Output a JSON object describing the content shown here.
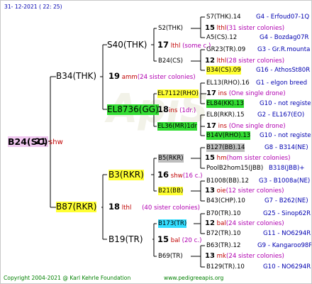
{
  "header": {
    "date": "31- 12-2021 ( 22: 25)"
  },
  "footer": {
    "copyright": "Copyright 2004-2021 @ Karl Kehrle Foundation",
    "url": "www.pedigreeapis.org"
  },
  "colors": {
    "accent_red": "#c00000",
    "link_blue": "#0000b0",
    "sister_magenta": "#b000b0",
    "highlight_yellow": "#ffff33",
    "highlight_green": "#33dd33",
    "highlight_cyan": "#33ddff",
    "highlight_grey": "#bdbdbd",
    "highlight_pink": "#f0c8f0"
  },
  "root": {
    "name": "B24(SC)",
    "num": "21",
    "line": "shw"
  },
  "g1": {
    "top": {
      "name": "B34(THK)",
      "num": "19",
      "line": "amm",
      "note": "(24 sister colonies)"
    },
    "bot": {
      "name": "B87(RKR)",
      "num": "18",
      "line": "lthl",
      "note": "(40 sister colonies)"
    }
  },
  "g2": [
    {
      "name": "S40(THK)",
      "num": "17",
      "line": "lthl",
      "note": "(some c.)"
    },
    {
      "name": "EL8736(GG)",
      "num": "18",
      "line": "ins",
      "note": "(1dr.)"
    },
    {
      "name": "B3(RKR)",
      "num": "16",
      "line": "shw",
      "note": "(16 c.)"
    },
    {
      "name": "B19(TR)",
      "num": "15",
      "line": "bal",
      "note": "(20 c.)"
    }
  ],
  "g3": [
    {
      "name": "S2(THK)",
      "num": "15",
      "line": "lthl",
      "note": "(31 sister colonies)"
    },
    {
      "name": "B24(CS)",
      "num": "12",
      "line": "lthl",
      "note": "(28 sister colonies)"
    },
    {
      "name": "EL7112(RHO)",
      "num": "17",
      "line": "ins",
      "note": "(One single drone)"
    },
    {
      "name": "EL36(MR)1dr",
      "num": "17",
      "line": "ins",
      "note": "(One single drone)"
    },
    {
      "name": "B5(RKR)",
      "num": "15",
      "line": "hm",
      "note": "(hom sister colonies)"
    },
    {
      "name": "B21(BB)",
      "num": "13",
      "line": "oie",
      "note": "(12 sister colonies)"
    },
    {
      "name": "B173(TR)",
      "num": "12",
      "line": "bal",
      "note": "(24 sister colonies)"
    },
    {
      "name": "B69(TR)",
      "num": "13",
      "line": "mk",
      "note": "(24 sister colonies)"
    }
  ],
  "g4": [
    {
      "name": "S7(THK).14",
      "info": "G4 - Erfoud07-1Q"
    },
    {
      "name": "A5(CS).12",
      "info": "G4 - Bozdag07R"
    },
    {
      "name": "GR23(TR).09",
      "info": "G3 - Gr.R.mounta"
    },
    {
      "name": "B34(CS).09",
      "info": "G16 - AthosSt80R"
    },
    {
      "name": "EL13(RHO).16",
      "info": "G1 - elgon breed"
    },
    {
      "name": "EL84(KK).13",
      "info": "G10 - not registe"
    },
    {
      "name": "EL8(RKR).15",
      "info": "G2 - EL167(EO)"
    },
    {
      "name": "B14V(RHO).13",
      "info": "G10 - not registe"
    },
    {
      "name": "B127(BB).14",
      "info": "G8 - B314(NE)"
    },
    {
      "name": "PoolB2hom15(JBB)",
      "info": "B318(JBB)+"
    },
    {
      "name": "B1008(BB).12",
      "info": "G3 - B1008a(NE)"
    },
    {
      "name": "B43(CHP).10",
      "info": "G7 - B262(NE)"
    },
    {
      "name": "B70(TR).10",
      "info": "G25 - Sinop62R"
    },
    {
      "name": "B72(TR).10",
      "info": "G11 - NO6294R"
    },
    {
      "name": "B63(TR).12",
      "info": "G9 - Kangaroo98R"
    },
    {
      "name": "B129(TR).10",
      "info": "G10 - NO6294R"
    }
  ]
}
